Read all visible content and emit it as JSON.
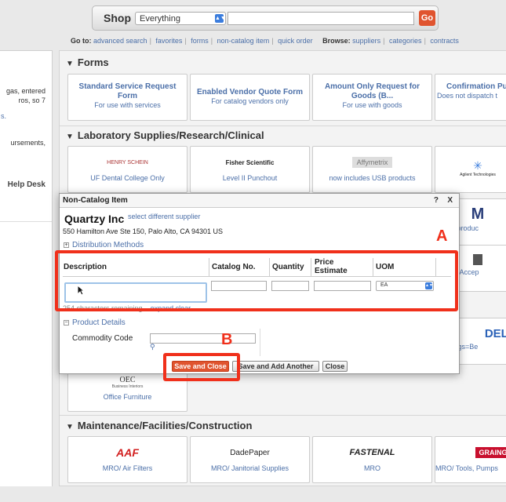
{
  "search": {
    "shop_label": "Shop",
    "category": "Everything",
    "go_label": "Go"
  },
  "nav": {
    "goto_label": "Go to:",
    "goto_links": [
      "advanced search",
      "favorites",
      "forms",
      "non-catalog item",
      "quick order"
    ],
    "browse_label": "Browse:",
    "browse_links": [
      "suppliers",
      "categories",
      "contracts"
    ]
  },
  "left_fragments": [
    "gas, entered",
    "ros, so 7",
    "s.",
    "ursements,",
    "Help Desk"
  ],
  "forms_section": {
    "title": "Forms",
    "cards": [
      {
        "title": "Standard Service Request Form",
        "sub": "For use with services"
      },
      {
        "title": "Enabled Vendor Quote Form",
        "sub": "For catalog vendors only"
      },
      {
        "title": "Amount Only Request for Goods (B...",
        "sub": "For use with goods"
      },
      {
        "title": "Confirmation Pu Request For",
        "sub": "Does not dispatch t"
      }
    ]
  },
  "lab_section": {
    "title": "Laboratory Supplies/Research/Clinical",
    "cards": [
      {
        "logo": "HENRY SCHEIN",
        "caption": "UF Dental College Only"
      },
      {
        "logo": "Fisher Scientific",
        "caption": "Level II Punchout"
      },
      {
        "logo": "Affymetrix",
        "caption": "now includes USB products"
      },
      {
        "logo": "Agilent Technologies",
        "caption": ""
      }
    ],
    "partial_right": [
      "lusive produc",
      "Cruz - Accep",
      "d Configs=Be"
    ]
  },
  "office_card": {
    "logo": "OEC",
    "logo_sub": "Business Interiors",
    "caption": "Office Furniture"
  },
  "maint_section": {
    "title": "Maintenance/Facilities/Construction",
    "cards": [
      {
        "logo": "AAF",
        "caption": "MRO/ Air Filters"
      },
      {
        "logo": "DadePaper",
        "caption": "MRO/ Janitorial Supplies"
      },
      {
        "logo": "FASTENAL",
        "caption": "MRO"
      },
      {
        "logo": "GRAINGER",
        "caption": "MRO/ Tools, Pumps"
      }
    ]
  },
  "modal": {
    "title": "Non-Catalog Item",
    "help": "?",
    "close": "X",
    "supplier_name": "Quartzy Inc",
    "select_supplier": "select different supplier",
    "supplier_address": "550 Hamilton Ave Ste 150, Palo Alto, CA 94301 US",
    "distribution_methods": "Distribution Methods",
    "columns": {
      "description": "Description",
      "catalog_no": "Catalog No.",
      "quantity": "Quantity",
      "price_estimate": "Price Estimate",
      "uom": "UOM"
    },
    "uom_value": "EA",
    "chars_remaining": "254 characters remaining",
    "expand": "expand",
    "clear": "clear",
    "product_details": "Product Details",
    "commodity_code": "Commodity Code",
    "buttons": {
      "save_close": "Save and Close",
      "save_add": "Save and Add Another",
      "close": "Close"
    }
  },
  "annotations": {
    "a": "A",
    "b": "B",
    "color": "#f0301b"
  },
  "colors": {
    "accent": "#e0542f",
    "link": "#4b6fa8",
    "highlight": "#f0301b"
  }
}
